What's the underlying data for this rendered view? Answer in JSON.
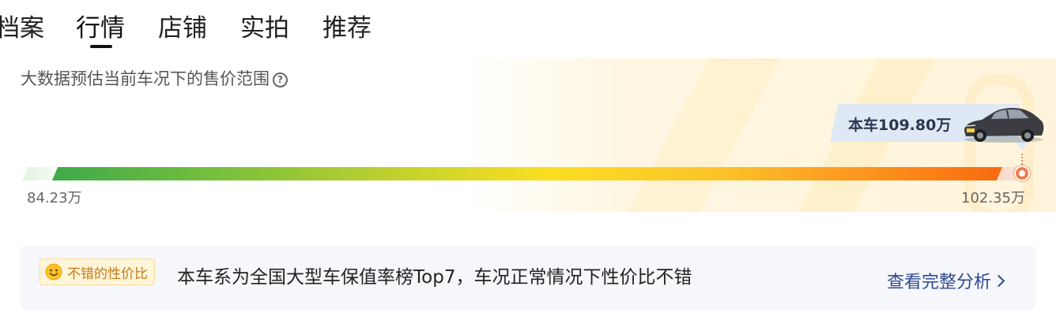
{
  "tabs": [
    {
      "label": "档案",
      "active": false
    },
    {
      "label": "行情",
      "active": true
    },
    {
      "label": "店铺",
      "active": false
    },
    {
      "label": "实拍",
      "active": false
    },
    {
      "label": "推荐",
      "active": false
    }
  ],
  "price_panel": {
    "subtitle": "大数据预估当前车况下的售价范围",
    "help_icon": "question-circle-icon",
    "min_price": "84.23万",
    "max_price": "102.35万",
    "current_label": "本车109.80万",
    "current_marker_position_fraction": 1.0,
    "car_icon": "car-photo"
  },
  "info": {
    "badge_icon": "smile-icon",
    "badge_label": "不错的性价比",
    "text": "本车系为全国大型车保值率榜Top7，车况正常情况下性价比不错",
    "link_label": "查看完整分析",
    "link_icon": "chevron-right-icon"
  },
  "colors": {
    "bar_start": "#3eaa4a",
    "bar_mid": "#fade22",
    "bar_end": "#f86a0f",
    "marker": "#f47b43",
    "link": "#2f4890",
    "badge_text": "#c67a16"
  }
}
